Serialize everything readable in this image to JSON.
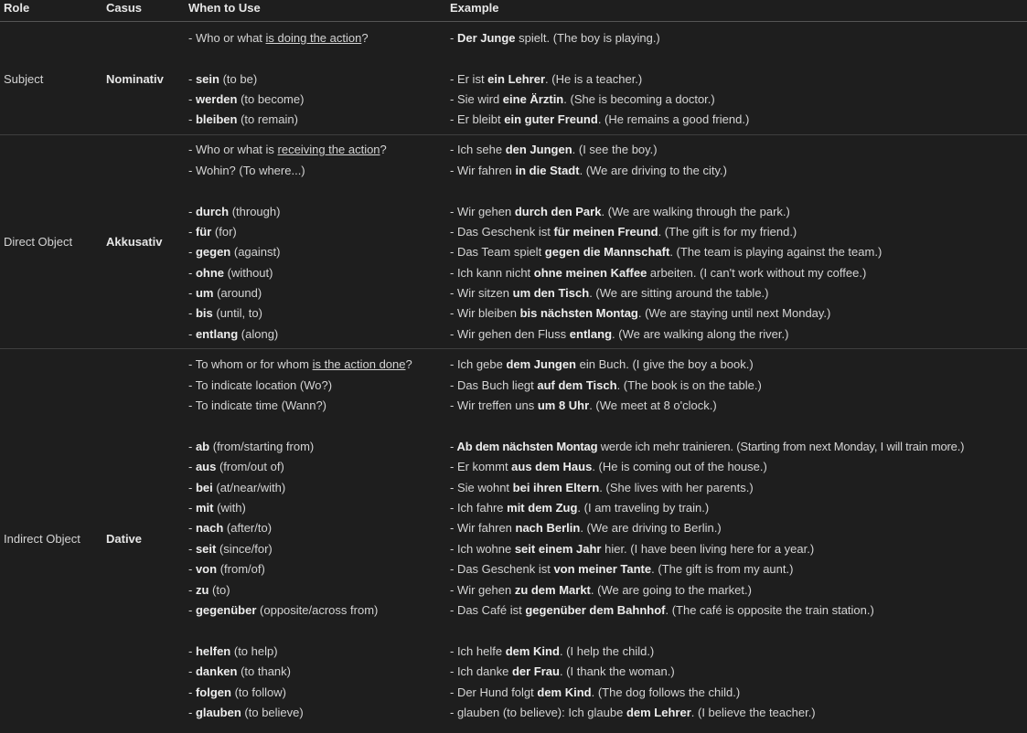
{
  "header": {
    "role": "Role",
    "casus": "Casus",
    "when": "When to Use",
    "example": "Example"
  },
  "rows": {
    "nominativ": {
      "role": "Subject",
      "casus": "Nominativ",
      "when": [
        {
          "pre": "- Who or what ",
          "u": "is doing the action",
          "post": "?"
        },
        {
          "pre": "- ",
          "b": "sein",
          "post": " (to be)"
        },
        {
          "pre": "- ",
          "b": "werden",
          "post": " (to become)"
        },
        {
          "pre": "- ",
          "b": "bleiben",
          "post": " (to remain)"
        }
      ],
      "examples": [
        {
          "pre": "- ",
          "b": "Der Junge",
          "post": " spielt. (The boy is playing.)"
        },
        {
          "pre": "- Er ist ",
          "b": "ein Lehrer",
          "post": ". (He is a teacher.)"
        },
        {
          "pre": "- Sie wird ",
          "b": "eine Ärztin",
          "post": ". (She is becoming a doctor.)"
        },
        {
          "pre": "- Er bleibt ",
          "b": "ein guter Freund",
          "post": ". (He remains a good friend.)"
        }
      ]
    },
    "akkusativ": {
      "role": "Direct Object",
      "casus": "Akkusativ",
      "when": [
        {
          "pre": "- Who or what is ",
          "u": "receiving the action",
          "post": "?"
        },
        {
          "pre": "- Wohin? (To where...)"
        },
        {
          "pre": "- ",
          "b": "durch",
          "post": " (through)"
        },
        {
          "pre": "- ",
          "b": "für",
          "post": " (for)"
        },
        {
          "pre": "- ",
          "b": "gegen",
          "post": " (against)"
        },
        {
          "pre": "- ",
          "b": "ohne",
          "post": " (without)"
        },
        {
          "pre": "- ",
          "b": "um",
          "post": " (around)"
        },
        {
          "pre": "- ",
          "b": "bis",
          "post": " (until, to)"
        },
        {
          "pre": "- ",
          "b": "entlang",
          "post": " (along)"
        }
      ],
      "examples": [
        {
          "pre": "- Ich sehe ",
          "b": "den Jungen",
          "post": ". (I see the boy.)"
        },
        {
          "pre": "- Wir fahren ",
          "b": "in die Stadt",
          "post": ". (We are driving to the city.)"
        },
        {
          "pre": "- Wir gehen ",
          "b": "durch den Park",
          "post": ". (We are walking through the park.)"
        },
        {
          "pre": "- Das Geschenk ist ",
          "b": "für meinen Freund",
          "post": ". (The gift is for my friend.)"
        },
        {
          "pre": "- Das Team spielt ",
          "b": "gegen die Mannschaft",
          "post": ". (The team is playing against the team.)"
        },
        {
          "pre": "- Ich kann nicht ",
          "b": "ohne meinen Kaffee",
          "post": " arbeiten. (I can't work without my coffee.)"
        },
        {
          "pre": "- Wir sitzen ",
          "b": "um den Tisch",
          "post": ". (We are sitting around the table.)"
        },
        {
          "pre": "- Wir bleiben ",
          "b": "bis nächsten Montag",
          "post": ". (We are staying until next Monday.)"
        },
        {
          "pre": "- Wir gehen den Fluss ",
          "b": "entlang",
          "post": ". (We are walking along the river.)"
        }
      ]
    },
    "dative": {
      "role": "Indirect Object",
      "casus": "Dative",
      "when": [
        {
          "pre": "- To whom or for whom ",
          "u": "is the action done",
          "post": "?"
        },
        {
          "pre": "- To indicate location (Wo?)"
        },
        {
          "pre": "- To indicate time (Wann?)"
        },
        {
          "pre": "- ",
          "b": "ab",
          "post": " (from/starting from)"
        },
        {
          "pre": "- ",
          "b": "aus",
          "post": " (from/out of)"
        },
        {
          "pre": "- ",
          "b": "bei",
          "post": " (at/near/with)"
        },
        {
          "pre": "- ",
          "b": "mit",
          "post": " (with)"
        },
        {
          "pre": "- ",
          "b": "nach",
          "post": " (after/to)"
        },
        {
          "pre": "- ",
          "b": "seit",
          "post": " (since/for)"
        },
        {
          "pre": "- ",
          "b": "von",
          "post": " (from/of)"
        },
        {
          "pre": "- ",
          "b": "zu",
          "post": " (to)"
        },
        {
          "pre": "- ",
          "b": "gegenüber",
          "post": " (opposite/across from)"
        },
        {
          "pre": "- ",
          "b": "helfen",
          "post": " (to help)"
        },
        {
          "pre": "- ",
          "b": "danken",
          "post": " (to thank)"
        },
        {
          "pre": "- ",
          "b": "folgen",
          "post": " (to follow)"
        },
        {
          "pre": "- ",
          "b": "glauben",
          "post": " (to believe)"
        }
      ],
      "examples": [
        {
          "pre": "- Ich gebe ",
          "b": "dem Jungen",
          "post": " ein Buch. (I give the boy a book.)"
        },
        {
          "pre": "- Das Buch liegt ",
          "b": "auf dem Tisch",
          "post": ". (The book is on the table.)"
        },
        {
          "pre": "- Wir treffen uns ",
          "b": "um 8 Uhr",
          "post": ". (We meet at 8 o'clock.)"
        },
        {
          "pre": "- ",
          "b": "Ab dem nächsten Montag",
          "post": " werde ich mehr trainieren. (Starting from next Monday, I will train more.)"
        },
        {
          "pre": "- Er kommt ",
          "b": "aus dem Haus",
          "post": ". (He is coming out of the house.)"
        },
        {
          "pre": "- Sie wohnt ",
          "b": "bei ihren Eltern",
          "post": ". (She lives with her parents.)"
        },
        {
          "pre": "- Ich fahre ",
          "b": "mit dem Zug",
          "post": ". (I am traveling by train.)"
        },
        {
          "pre": "- Wir fahren ",
          "b": "nach Berlin",
          "post": ". (We are driving to Berlin.)"
        },
        {
          "pre": "- Ich wohne ",
          "b": "seit einem Jahr",
          "post": " hier. (I have been living here for a year.)"
        },
        {
          "pre": "- Das Geschenk ist ",
          "b": "von meiner Tante",
          "post": ". (The gift is from my aunt.)"
        },
        {
          "pre": "- Wir gehen ",
          "b": "zu dem Markt",
          "post": ". (We are going to the market.)"
        },
        {
          "pre": "- Das Café ist ",
          "b": "gegenüber dem Bahnhof",
          "post": ". (The café is opposite the train station.)"
        },
        {
          "pre": "- Ich helfe ",
          "b": "dem Kind",
          "post": ". (I help the child.)"
        },
        {
          "pre": "- Ich danke ",
          "b": "der Frau",
          "post": ". (I thank the woman.)"
        },
        {
          "pre": "- Der Hund folgt ",
          "b": "dem Kind",
          "post": ". (The dog follows the child.)"
        },
        {
          "pre": "- glauben (to believe): Ich glaube ",
          "b": "dem Lehrer",
          "post": ". (I believe the teacher.)"
        }
      ]
    }
  }
}
